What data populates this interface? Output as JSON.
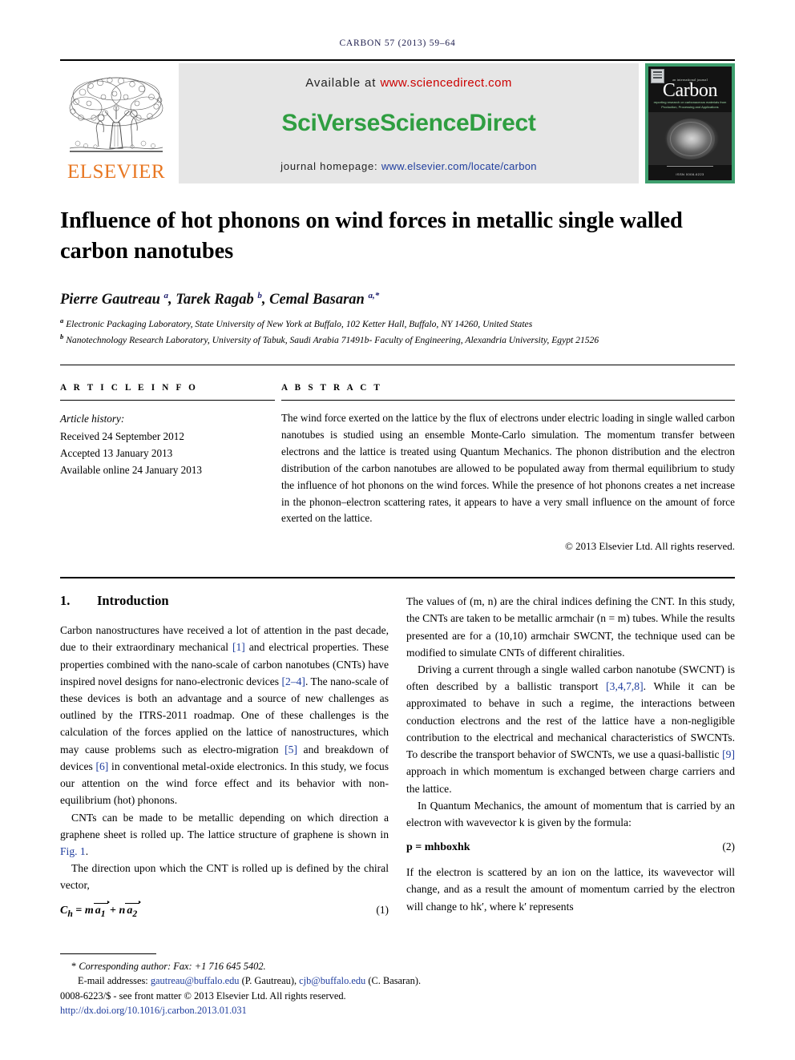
{
  "running_head": {
    "journal": "CARBON",
    "volume_line": "57 (2013) 59–64"
  },
  "masthead": {
    "publisher_name": "ELSEVIER",
    "available_prefix": "Available at",
    "available_url": "www.sciencedirect.com",
    "platform_part1": "SciVerse",
    "platform_part2": "ScienceDirect",
    "homepage_prefix": "journal homepage:",
    "homepage_url": "www.elsevier.com/locate/carbon",
    "cover": {
      "sub": "an international journal",
      "title": "Carbon",
      "strapline": "reporting research on carbonaceous materials from Production, Processing and Applications",
      "footer": "ISSN 0008-6223"
    }
  },
  "article": {
    "title": "Influence of hot phonons on wind forces in metallic single walled carbon nanotubes",
    "authors_html": "Pierre Gautreau <sup>a</sup>, Tarek Ragab <sup>b</sup>, Cemal Basaran <sup>a,*</sup>",
    "affiliation_a": "Electronic Packaging Laboratory, State University of New York at Buffalo, 102 Ketter Hall, Buffalo, NY 14260, United States",
    "affiliation_b": "Nanotechnology Research Laboratory, University of Tabuk, Saudi Arabia 71491b- Faculty of Engineering, Alexandria University, Egypt 21526"
  },
  "info": {
    "heading": "A R T I C L E   I N F O",
    "history_label": "Article history:",
    "received": "Received 24 September 2012",
    "accepted": "Accepted 13 January 2013",
    "available_online": "Available online 24 January 2013"
  },
  "abstract": {
    "heading": "A B S T R A C T",
    "text": "The wind force exerted on the lattice by the flux of electrons under electric loading in single walled carbon nanotubes is studied using an ensemble Monte-Carlo simulation. The momentum transfer between electrons and the lattice is treated using Quantum Mechanics. The phonon distribution and the electron distribution of the carbon nanotubes are allowed to be populated away from thermal equilibrium to study the influence of hot phonons on the wind forces. While the presence of hot phonons creates a net increase in the phonon–electron scattering rates, it appears to have a very small influence on the amount of force exerted on the lattice.",
    "copyright": "© 2013 Elsevier Ltd. All rights reserved."
  },
  "sections": {
    "intro_number": "1.",
    "intro_title": "Introduction"
  },
  "body": {
    "left": {
      "p1_a": "Carbon nanostructures have received a lot of attention in the past decade, due to their extraordinary mechanical ",
      "p1_ref1": "[1]",
      "p1_b": " and electrical properties. These properties combined with the nano-scale of carbon nanotubes (CNTs) have inspired novel designs for nano-electronic devices ",
      "p1_ref2": "[2–4]",
      "p1_c": ". The nano-scale of these devices is both an advantage and a source of new challenges as outlined by the ITRS-2011 roadmap. One of these challenges is the calculation of the forces applied on the lattice of nanostructures, which may cause problems such as electro-migration ",
      "p1_ref3": "[5]",
      "p1_d": " and breakdown of devices ",
      "p1_ref4": "[6]",
      "p1_e": " in conventional metal-oxide electronics. In this study, we focus our attention on the wind force effect and its behavior with non-equilibrium (hot) phonons.",
      "p2_a": "CNTs can be made to be metallic depending on which direction a graphene sheet is rolled up. The lattice structure of graphene is shown in ",
      "p2_figref": "Fig. 1",
      "p2_b": ".",
      "p3": "The direction upon which the CNT is rolled up is defined by the chiral vector,",
      "eq1_lhs": "C",
      "eq1_sub": "h",
      "eq1_eq": "=",
      "eq1_m": "m",
      "eq1_a1": "a",
      "eq1_a1sub": "1",
      "eq1_plus": "+",
      "eq1_n": "n",
      "eq1_a2": "a",
      "eq1_a2sub": "2",
      "eq1_num": "(1)"
    },
    "right": {
      "p1": "The values of (m, n) are the chiral indices defining the CNT. In this study, the CNTs are taken to be metallic armchair (n = m) tubes. While the results presented are for a (10,10) armchair SWCNT, the technique used can be modified to simulate CNTs of different chiralities.",
      "p2_a": "Driving a current through a single walled carbon nanotube (SWCNT) is often described by a ballistic transport ",
      "p2_ref1": "[3,4,7,8]",
      "p2_b": ". While it can be approximated to behave in such a regime, the interactions between conduction electrons and the rest of the lattice have a non-negligible contribution to the electrical and mechanical characteristics of SWCNTs. To describe the transport behavior of SWCNTs, we use a quasi-ballistic ",
      "p2_ref2": "[9]",
      "p2_c": " approach in which momentum is exchanged between charge carriers and the lattice.",
      "p3": "In Quantum Mechanics, the amount of momentum that is carried by an electron with wavevector k is given by the formula:",
      "eq2": "p = mhboxhk",
      "eq2_num": "(2)",
      "p4": "If the electron is scattered by an ion on the lattice, its wavevector will change, and as a result the amount of momentum carried by the electron will change to hk′, where k′ represents"
    }
  },
  "footer": {
    "corresponding_star": "*",
    "corresponding": "Corresponding author: Fax: +1 716 645 5402.",
    "email_label": "E-mail addresses:",
    "email1": "gautreau@buffalo.edu",
    "email1_name": "(P. Gautreau),",
    "email2": "cjb@buffalo.edu",
    "email2_name": "(C. Basaran).",
    "issn_line": "0008-6223/$ - see front matter © 2013 Elsevier Ltd. All rights reserved.",
    "doi": "http://dx.doi.org/10.1016/j.carbon.2013.01.031"
  },
  "colors": {
    "link": "#1f3d9e",
    "elsevier_orange": "#e87722",
    "sciencedirect_green": "#2f9e41",
    "url_red": "#cc0000",
    "cover_green": "#3e9f6e"
  }
}
